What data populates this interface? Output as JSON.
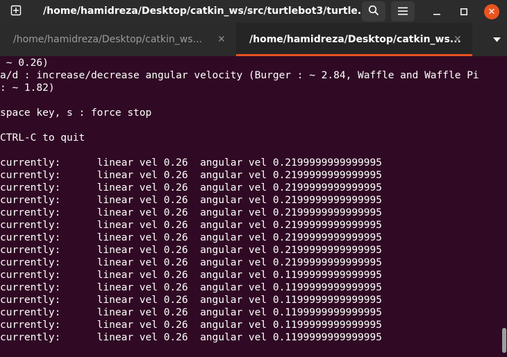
{
  "window": {
    "title": "/home/hamidreza/Desktop/catkin_ws/src/turtlebot3/turtle...",
    "close_glyph": "✕"
  },
  "tabs": [
    {
      "label": "/home/hamidreza/Desktop/catkin_ws...",
      "close": "✕"
    },
    {
      "label": "/home/hamidreza/Desktop/catkin_ws...",
      "close": "✕"
    }
  ],
  "terminal": {
    "lines": [
      " ~ 0.26)",
      "a/d : increase/decrease angular velocity (Burger : ~ 2.84, Waffle and Waffle Pi",
      ": ~ 1.82)",
      "",
      "space key, s : force stop",
      "",
      "CTRL-C to quit",
      "",
      "currently:      linear vel 0.26  angular vel 0.2199999999999995",
      "currently:      linear vel 0.26  angular vel 0.2199999999999995",
      "currently:      linear vel 0.26  angular vel 0.2199999999999995",
      "currently:      linear vel 0.26  angular vel 0.2199999999999995",
      "currently:      linear vel 0.26  angular vel 0.2199999999999995",
      "currently:      linear vel 0.26  angular vel 0.2199999999999995",
      "currently:      linear vel 0.26  angular vel 0.2199999999999995",
      "currently:      linear vel 0.26  angular vel 0.2199999999999995",
      "currently:      linear vel 0.26  angular vel 0.2199999999999995",
      "currently:      linear vel 0.26  angular vel 0.1199999999999995",
      "currently:      linear vel 0.26  angular vel 0.1199999999999995",
      "currently:      linear vel 0.26  angular vel 0.1199999999999995",
      "currently:      linear vel 0.26  angular vel 0.1199999999999995",
      "currently:      linear vel 0.26  angular vel 0.1199999999999995",
      "currently:      linear vel 0.26  angular vel 0.1199999999999995"
    ]
  },
  "colors": {
    "terminal_bg": "#300a24",
    "accent": "#e95420",
    "text": "#ffffff"
  },
  "icons": {
    "new_tab": "new-tab-icon",
    "search": "search-icon",
    "menu": "hamburger-menu-icon",
    "minimize": "minimize-icon",
    "maximize": "maximize-icon",
    "close": "close-icon",
    "tab_menu": "chevron-down-icon"
  }
}
